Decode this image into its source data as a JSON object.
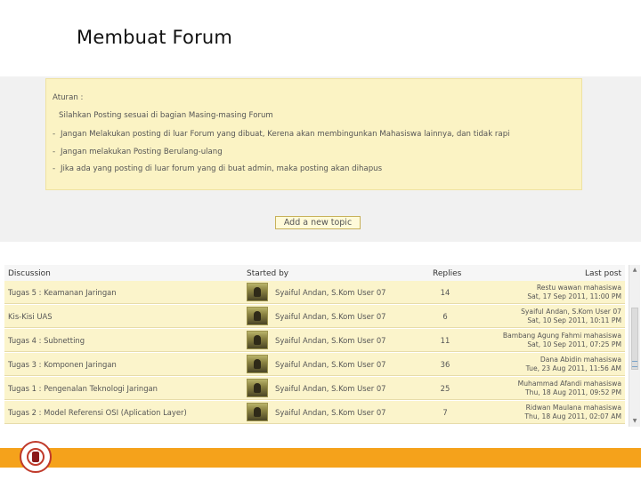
{
  "slide": {
    "title": "Membuat Forum"
  },
  "rules": {
    "title": "Aturan :",
    "intro": "Silahkan Posting sesuai di bagian Masing-masing Forum",
    "items": [
      "Jangan Melakukan posting di luar Forum yang dibuat, Kerena akan membingunkan Mahasiswa lainnya, dan tidak rapi",
      "Jangan melakukan Posting Berulang-ulang",
      "Jika ada yang posting di luar forum yang di buat admin, maka posting akan dihapus"
    ]
  },
  "add_topic": {
    "label": "Add a new topic"
  },
  "table": {
    "headers": {
      "discussion": "Discussion",
      "started_by": "Started by",
      "replies": "Replies",
      "last_post": "Last post"
    },
    "rows": [
      {
        "topic": "Tugas 5 : Keamanan Jaringan",
        "starter": "Syaiful Andan, S.Kom User 07",
        "replies": "14",
        "last_line1": "Restu wawan mahasiswa",
        "last_line2": "Sat, 17 Sep 2011, 11:00 PM"
      },
      {
        "topic": "Kis-Kisi UAS",
        "starter": "Syaiful Andan, S.Kom User 07",
        "replies": "6",
        "last_line1": "Syaiful Andan, S.Kom User 07",
        "last_line2": "Sat, 10 Sep 2011, 10:11 PM"
      },
      {
        "topic": "Tugas 4 : Subnetting",
        "starter": "Syaiful Andan, S.Kom User 07",
        "replies": "11",
        "last_line1": "Bambang Agung Fahmi mahasiswa",
        "last_line2": "Sat, 10 Sep 2011, 07:25 PM"
      },
      {
        "topic": "Tugas 3 : Komponen Jaringan",
        "starter": "Syaiful Andan, S.Kom User 07",
        "replies": "36",
        "last_line1": "Dana Abidin mahasiswa",
        "last_line2": "Tue, 23 Aug 2011, 11:56 AM"
      },
      {
        "topic": "Tugas 1 : Pengenalan Teknologi Jaringan",
        "starter": "Syaiful Andan, S.Kom User 07",
        "replies": "25",
        "last_line1": "Muhammad Afandi mahasiswa",
        "last_line2": "Thu, 18 Aug 2011, 09:52 PM"
      },
      {
        "topic": "Tugas 2 : Model Referensi OSI (Aplication Layer)",
        "starter": "Syaiful Andan, S.Kom User 07",
        "replies": "7",
        "last_line1": "Ridwan Maulana mahasiswa",
        "last_line2": "Thu, 18 Aug 2011, 02:07 AM"
      }
    ]
  },
  "colors": {
    "rules_bg": "#fbf3c4",
    "row_bg": "#fbf4cb",
    "bottom_bar": "#f5a21b",
    "logo_red": "#c03a2b"
  }
}
